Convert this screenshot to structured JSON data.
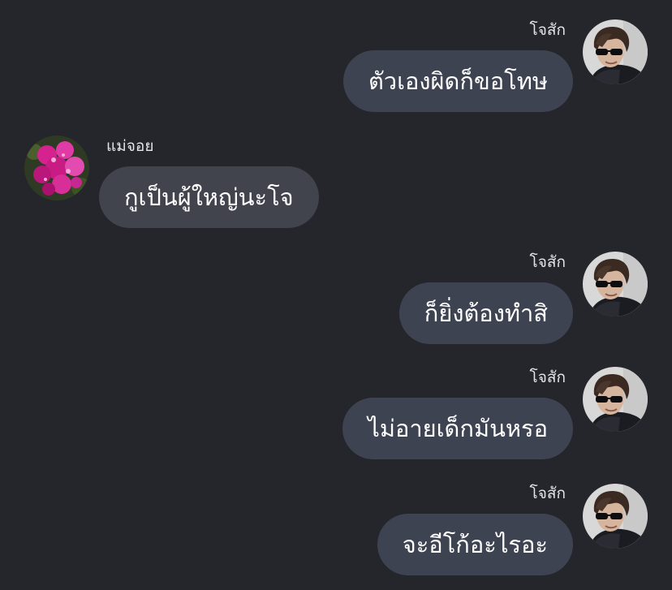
{
  "messages": [
    {
      "sender": "โจสัก",
      "text": "ตัวเองผิดก็ขอโทษ",
      "avatar_icon": "user-photo-sunglasses"
    },
    {
      "sender": "แม่จอย",
      "text": "กูเป็นผู้ใหญ่นะโจ",
      "avatar_icon": "user-photo-pink-flowers"
    },
    {
      "sender": "โจสัก",
      "text": "ก็ยิ่งต้องทำสิ",
      "avatar_icon": "user-photo-sunglasses"
    },
    {
      "sender": "โจสัก",
      "text": "ไม่อายเด็กมันหรอ",
      "avatar_icon": "user-photo-sunglasses"
    },
    {
      "sender": "โจสัก",
      "text": "จะอีโก้อะไรอะ",
      "avatar_icon": "user-photo-sunglasses"
    }
  ],
  "colors": {
    "background": "#25252c",
    "bubble": "#3e4352",
    "text": "#ffffff",
    "sender": "#e6e6ea"
  }
}
